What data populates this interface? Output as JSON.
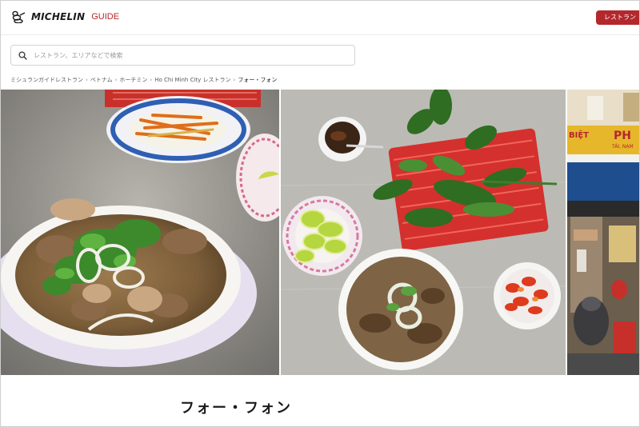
{
  "header": {
    "logo_word": "MICHELIN",
    "logo_sub": "GUIDE",
    "reserve_label": "レストラン"
  },
  "search": {
    "placeholder": "レストラン、エリアなどで検索",
    "icon": "search-icon"
  },
  "breadcrumbs": [
    "ミシュランガイドレストラン",
    "ベトナム",
    "ホーチミン",
    "Ho Chi Minh City レストラン",
    "フォー・フォン"
  ],
  "restaurant": {
    "name": "フォー・フォン"
  },
  "signage": {
    "sign_1": "BIỆT",
    "sign_2": "PH",
    "sign_3": "TÁI, NẠM"
  },
  "colors": {
    "brand_red": "#b3282d"
  }
}
